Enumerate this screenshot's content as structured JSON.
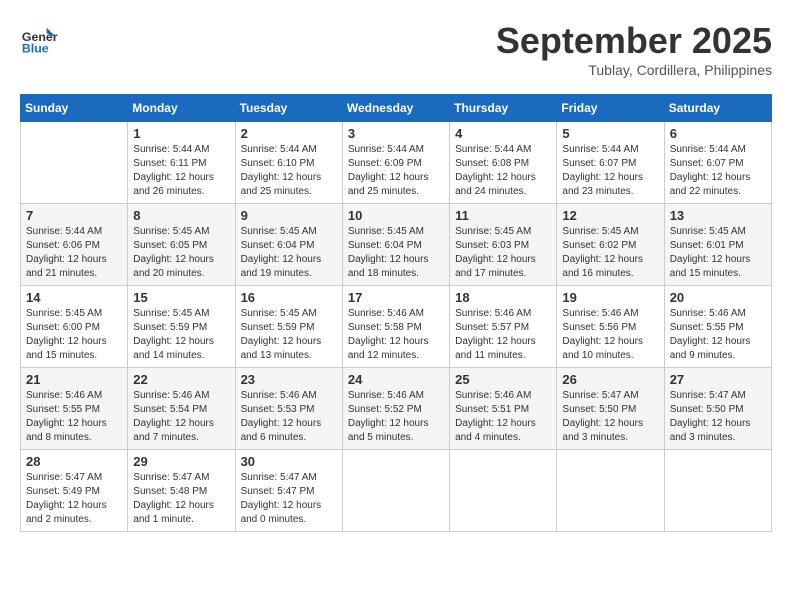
{
  "header": {
    "logo_line1": "General",
    "logo_line2": "Blue",
    "month": "September 2025",
    "location": "Tublay, Cordillera, Philippines"
  },
  "days_of_week": [
    "Sunday",
    "Monday",
    "Tuesday",
    "Wednesday",
    "Thursday",
    "Friday",
    "Saturday"
  ],
  "weeks": [
    [
      {
        "day": "",
        "info": ""
      },
      {
        "day": "1",
        "info": "Sunrise: 5:44 AM\nSunset: 6:11 PM\nDaylight: 12 hours\nand 26 minutes."
      },
      {
        "day": "2",
        "info": "Sunrise: 5:44 AM\nSunset: 6:10 PM\nDaylight: 12 hours\nand 25 minutes."
      },
      {
        "day": "3",
        "info": "Sunrise: 5:44 AM\nSunset: 6:09 PM\nDaylight: 12 hours\nand 25 minutes."
      },
      {
        "day": "4",
        "info": "Sunrise: 5:44 AM\nSunset: 6:08 PM\nDaylight: 12 hours\nand 24 minutes."
      },
      {
        "day": "5",
        "info": "Sunrise: 5:44 AM\nSunset: 6:07 PM\nDaylight: 12 hours\nand 23 minutes."
      },
      {
        "day": "6",
        "info": "Sunrise: 5:44 AM\nSunset: 6:07 PM\nDaylight: 12 hours\nand 22 minutes."
      }
    ],
    [
      {
        "day": "7",
        "info": "Sunrise: 5:44 AM\nSunset: 6:06 PM\nDaylight: 12 hours\nand 21 minutes."
      },
      {
        "day": "8",
        "info": "Sunrise: 5:45 AM\nSunset: 6:05 PM\nDaylight: 12 hours\nand 20 minutes."
      },
      {
        "day": "9",
        "info": "Sunrise: 5:45 AM\nSunset: 6:04 PM\nDaylight: 12 hours\nand 19 minutes."
      },
      {
        "day": "10",
        "info": "Sunrise: 5:45 AM\nSunset: 6:04 PM\nDaylight: 12 hours\nand 18 minutes."
      },
      {
        "day": "11",
        "info": "Sunrise: 5:45 AM\nSunset: 6:03 PM\nDaylight: 12 hours\nand 17 minutes."
      },
      {
        "day": "12",
        "info": "Sunrise: 5:45 AM\nSunset: 6:02 PM\nDaylight: 12 hours\nand 16 minutes."
      },
      {
        "day": "13",
        "info": "Sunrise: 5:45 AM\nSunset: 6:01 PM\nDaylight: 12 hours\nand 15 minutes."
      }
    ],
    [
      {
        "day": "14",
        "info": "Sunrise: 5:45 AM\nSunset: 6:00 PM\nDaylight: 12 hours\nand 15 minutes."
      },
      {
        "day": "15",
        "info": "Sunrise: 5:45 AM\nSunset: 5:59 PM\nDaylight: 12 hours\nand 14 minutes."
      },
      {
        "day": "16",
        "info": "Sunrise: 5:45 AM\nSunset: 5:59 PM\nDaylight: 12 hours\nand 13 minutes."
      },
      {
        "day": "17",
        "info": "Sunrise: 5:46 AM\nSunset: 5:58 PM\nDaylight: 12 hours\nand 12 minutes."
      },
      {
        "day": "18",
        "info": "Sunrise: 5:46 AM\nSunset: 5:57 PM\nDaylight: 12 hours\nand 11 minutes."
      },
      {
        "day": "19",
        "info": "Sunrise: 5:46 AM\nSunset: 5:56 PM\nDaylight: 12 hours\nand 10 minutes."
      },
      {
        "day": "20",
        "info": "Sunrise: 5:46 AM\nSunset: 5:55 PM\nDaylight: 12 hours\nand 9 minutes."
      }
    ],
    [
      {
        "day": "21",
        "info": "Sunrise: 5:46 AM\nSunset: 5:55 PM\nDaylight: 12 hours\nand 8 minutes."
      },
      {
        "day": "22",
        "info": "Sunrise: 5:46 AM\nSunset: 5:54 PM\nDaylight: 12 hours\nand 7 minutes."
      },
      {
        "day": "23",
        "info": "Sunrise: 5:46 AM\nSunset: 5:53 PM\nDaylight: 12 hours\nand 6 minutes."
      },
      {
        "day": "24",
        "info": "Sunrise: 5:46 AM\nSunset: 5:52 PM\nDaylight: 12 hours\nand 5 minutes."
      },
      {
        "day": "25",
        "info": "Sunrise: 5:46 AM\nSunset: 5:51 PM\nDaylight: 12 hours\nand 4 minutes."
      },
      {
        "day": "26",
        "info": "Sunrise: 5:47 AM\nSunset: 5:50 PM\nDaylight: 12 hours\nand 3 minutes."
      },
      {
        "day": "27",
        "info": "Sunrise: 5:47 AM\nSunset: 5:50 PM\nDaylight: 12 hours\nand 3 minutes."
      }
    ],
    [
      {
        "day": "28",
        "info": "Sunrise: 5:47 AM\nSunset: 5:49 PM\nDaylight: 12 hours\nand 2 minutes."
      },
      {
        "day": "29",
        "info": "Sunrise: 5:47 AM\nSunset: 5:48 PM\nDaylight: 12 hours\nand 1 minute."
      },
      {
        "day": "30",
        "info": "Sunrise: 5:47 AM\nSunset: 5:47 PM\nDaylight: 12 hours\nand 0 minutes."
      },
      {
        "day": "",
        "info": ""
      },
      {
        "day": "",
        "info": ""
      },
      {
        "day": "",
        "info": ""
      },
      {
        "day": "",
        "info": ""
      }
    ]
  ]
}
